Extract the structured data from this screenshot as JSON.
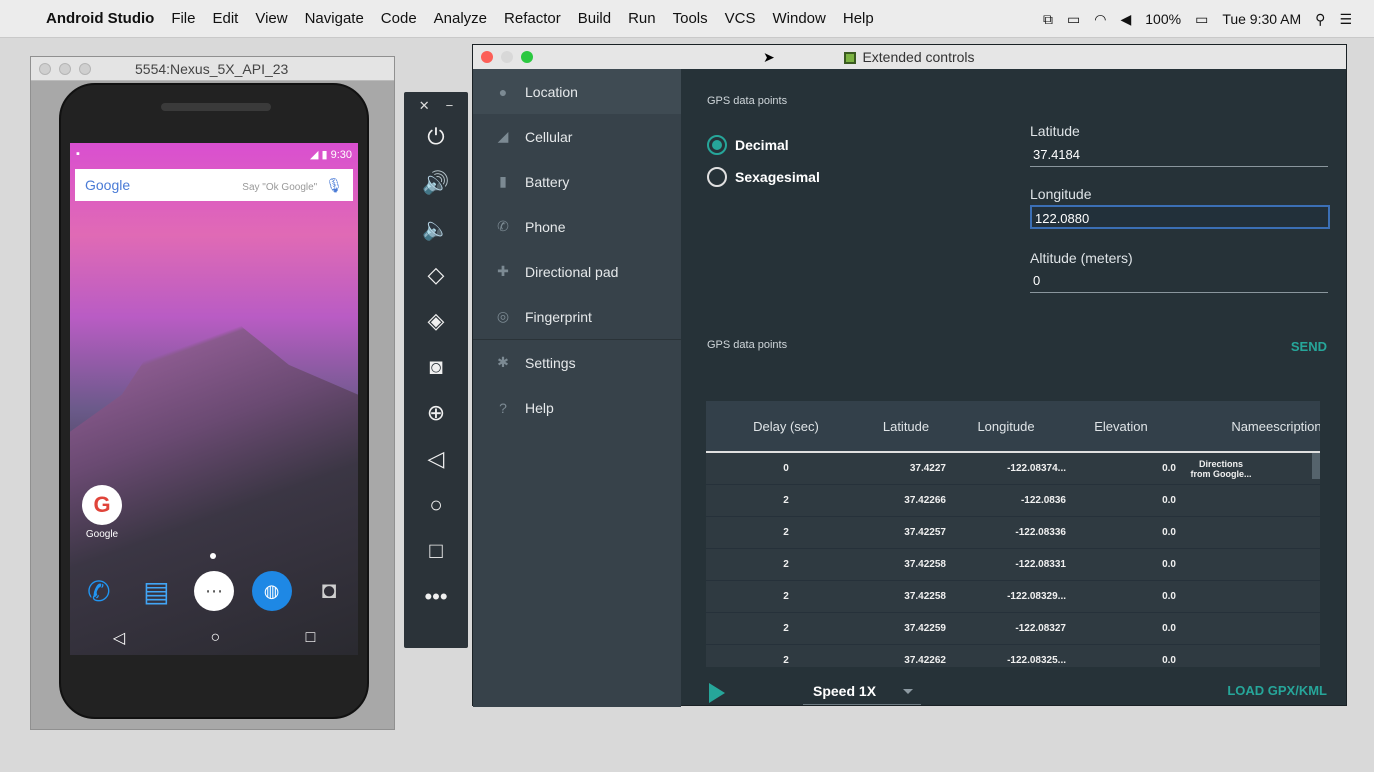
{
  "menubar": {
    "apple": "",
    "app": "Android Studio",
    "items": [
      "File",
      "Edit",
      "View",
      "Navigate",
      "Code",
      "Analyze",
      "Refactor",
      "Build",
      "Run",
      "Tools",
      "VCS",
      "Window",
      "Help"
    ],
    "battery": "100%",
    "clock": "Tue 9:30 AM"
  },
  "emulator": {
    "title": "5554:Nexus_5X_API_23",
    "status_time": "9:30",
    "google_logo": "Google",
    "google_hint": "Say \"Ok Google\"",
    "app_label": "Google"
  },
  "ext": {
    "title": "Extended controls",
    "sidebar": [
      {
        "label": "Location",
        "icon": "location-pin-icon"
      },
      {
        "label": "Cellular",
        "icon": "signal-icon"
      },
      {
        "label": "Battery",
        "icon": "battery-icon"
      },
      {
        "label": "Phone",
        "icon": "phone-icon"
      },
      {
        "label": "Directional pad",
        "icon": "dpad-icon"
      },
      {
        "label": "Fingerprint",
        "icon": "fingerprint-icon"
      },
      {
        "label": "Settings",
        "icon": "gear-icon"
      },
      {
        "label": "Help",
        "icon": "help-icon"
      }
    ],
    "gps_title_top": "GPS data points",
    "radio_decimal": "Decimal",
    "radio_sexagesimal": "Sexagesimal",
    "latitude_label": "Latitude",
    "latitude_value": "37.4184",
    "longitude_label": "Longitude",
    "longitude_value": "122.0880",
    "altitude_label": "Altitude (meters)",
    "altitude_value": "0",
    "send": "SEND",
    "gps_title_bottom": "GPS data points",
    "table": {
      "headers": [
        "Delay (sec)",
        "Latitude",
        "Longitude",
        "Elevation",
        "Name",
        "escription"
      ],
      "rows": [
        [
          "0",
          "37.4227",
          "-122.08374...",
          "0.0",
          "Directions\nfrom Google...",
          ""
        ],
        [
          "2",
          "37.42266",
          "-122.0836",
          "0.0",
          "",
          ""
        ],
        [
          "2",
          "37.42257",
          "-122.08336",
          "0.0",
          "",
          ""
        ],
        [
          "2",
          "37.42258",
          "-122.08331",
          "0.0",
          "",
          ""
        ],
        [
          "2",
          "37.42258",
          "-122.08329...",
          "0.0",
          "",
          ""
        ],
        [
          "2",
          "37.42259",
          "-122.08327",
          "0.0",
          "",
          ""
        ],
        [
          "2",
          "37.42262",
          "-122.08325...",
          "0.0",
          "",
          ""
        ]
      ]
    },
    "speed": "Speed 1X",
    "load": "LOAD GPX/KML"
  }
}
